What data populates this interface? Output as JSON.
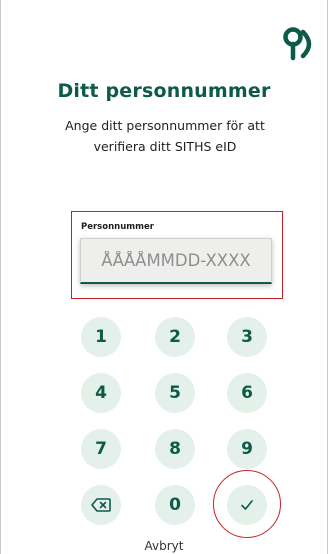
{
  "header": {
    "logo_icon": "siths-logo-icon",
    "title": "Ditt personnummer",
    "subtitle": "Ange ditt personnummer för att verifiera ditt SITHS eID"
  },
  "field": {
    "label": "Personnummer",
    "value": "",
    "placeholder": "ÅÅÅÅMMDD-XXXX"
  },
  "keypad": {
    "keys": [
      "1",
      "2",
      "3",
      "4",
      "5",
      "6",
      "7",
      "8",
      "9"
    ],
    "zero": "0",
    "backspace_icon": "backspace-icon",
    "confirm_icon": "checkmark-icon"
  },
  "footer": {
    "cancel_label": "Avbryt"
  },
  "colors": {
    "primary": "#0e5a49",
    "key_background": "#e3f1ea",
    "highlight": "#c8202a"
  }
}
